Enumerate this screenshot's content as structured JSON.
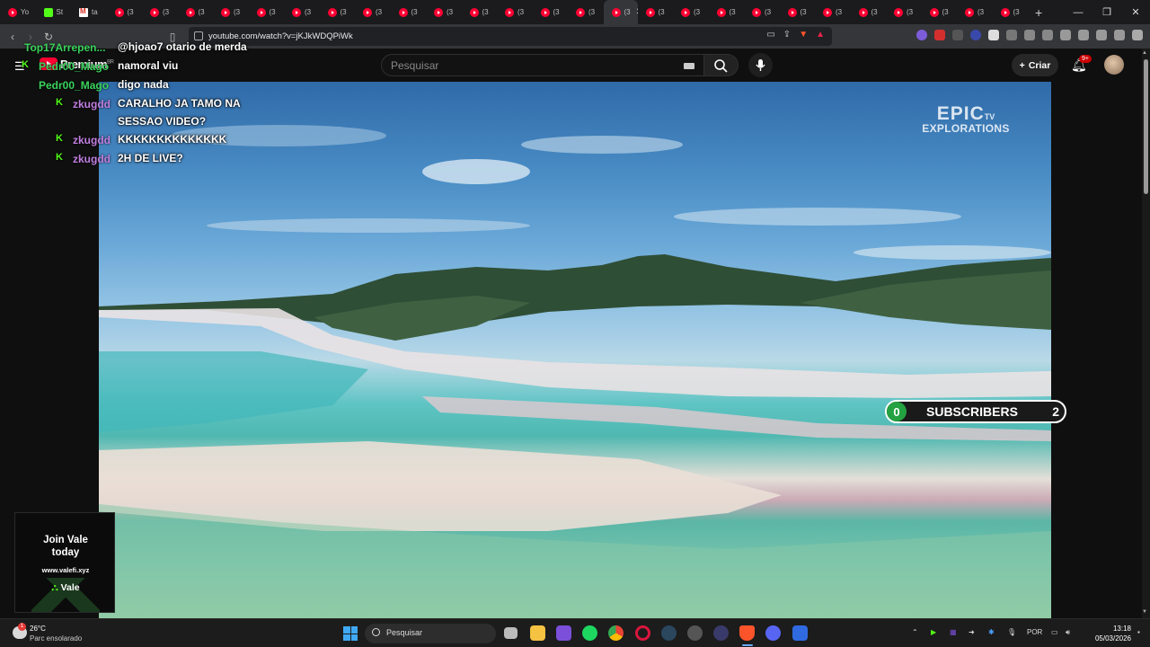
{
  "browser": {
    "tabs": [
      {
        "title": "Yo",
        "fav": "youtube"
      },
      {
        "title": "St",
        "fav": "kick"
      },
      {
        "title": "ta",
        "fav": "gmail"
      },
      {
        "title": "(3",
        "fav": "youtube"
      },
      {
        "title": "(3",
        "fav": "youtube"
      },
      {
        "title": "(3",
        "fav": "youtube"
      },
      {
        "title": "(3",
        "fav": "youtube"
      },
      {
        "title": "(3",
        "fav": "youtube"
      },
      {
        "title": "(3",
        "fav": "youtube"
      },
      {
        "title": "(3",
        "fav": "youtube"
      },
      {
        "title": "(3",
        "fav": "youtube"
      },
      {
        "title": "(3",
        "fav": "youtube"
      },
      {
        "title": "(3",
        "fav": "youtube"
      },
      {
        "title": "(3",
        "fav": "youtube"
      },
      {
        "title": "(3",
        "fav": "youtube"
      },
      {
        "title": "(3",
        "fav": "youtube"
      },
      {
        "title": "(3",
        "fav": "youtube"
      }
    ],
    "active_tab": {
      "title": "(3",
      "close": "✕"
    },
    "tabs_after": [
      {
        "title": "(3",
        "fav": "youtube"
      },
      {
        "title": "(3",
        "fav": "youtube"
      },
      {
        "title": "(3",
        "fav": "youtube"
      },
      {
        "title": "(3",
        "fav": "youtube"
      },
      {
        "title": "(3",
        "fav": "youtube"
      },
      {
        "title": "(3",
        "fav": "youtube"
      },
      {
        "title": "(3",
        "fav": "youtube"
      },
      {
        "title": "(3",
        "fav": "youtube"
      },
      {
        "title": "(3",
        "fav": "youtube"
      },
      {
        "title": "(3",
        "fav": "youtube"
      },
      {
        "title": "(3",
        "fav": "youtube"
      }
    ],
    "new_tab": "+",
    "url": "youtube.com/watch?v=jKJkWDQPiWk",
    "window_controls": [
      "—",
      "❐",
      "✕"
    ]
  },
  "youtube": {
    "logo_text": "Premium",
    "logo_country": "BR",
    "search_placeholder": "Pesquisar",
    "create_label": "Criar",
    "notification_badge": "9+"
  },
  "video": {
    "watermark_main": "EPIC",
    "watermark_tv": "TV",
    "watermark_sub": "EXPLORATIONS",
    "subscriber_overlay": {
      "left_count": "0",
      "label": "SUBSCRIBERS",
      "right_count": "2"
    }
  },
  "chat": [
    {
      "badge": false,
      "user": "Top17Arrepen...",
      "user_color": "#3ad35c",
      "text": "@hjoao7 otario de merda"
    },
    {
      "badge": true,
      "user": "Pedr00_Mago",
      "user_color": "#3ad35c",
      "text": "namoral viu"
    },
    {
      "badge": false,
      "user": "Pedr00_Mago",
      "user_color": "#3ad35c",
      "text": "digo nada"
    },
    {
      "badge": true,
      "user": "zkugdd",
      "user_color": "#c07ee0",
      "text": "CARALHO JA TAMO NA",
      "text2": "SESSAO VIDEO?"
    },
    {
      "badge": true,
      "user": "zkugdd",
      "user_color": "#c07ee0",
      "text": "KKKKKKKKKKKKKK"
    },
    {
      "badge": true,
      "user": "zkugdd",
      "user_color": "#c07ee0",
      "text": "2H DE LIVE?"
    }
  ],
  "ad": {
    "line1": "Join Vale",
    "line2": "today",
    "url": "www.valefi.xyz",
    "brand": "Vale"
  },
  "taskbar": {
    "weather_temp": "26°C",
    "weather_desc": "Parc ensolarado",
    "weather_alert": "1",
    "search_label": "Pesquisar",
    "language": "POR",
    "time": "13:18",
    "date": "05/03/2026"
  },
  "colors": {
    "kick_green": "#53fc18",
    "youtube_red": "#ff0033",
    "subs_green": "#24a140"
  }
}
